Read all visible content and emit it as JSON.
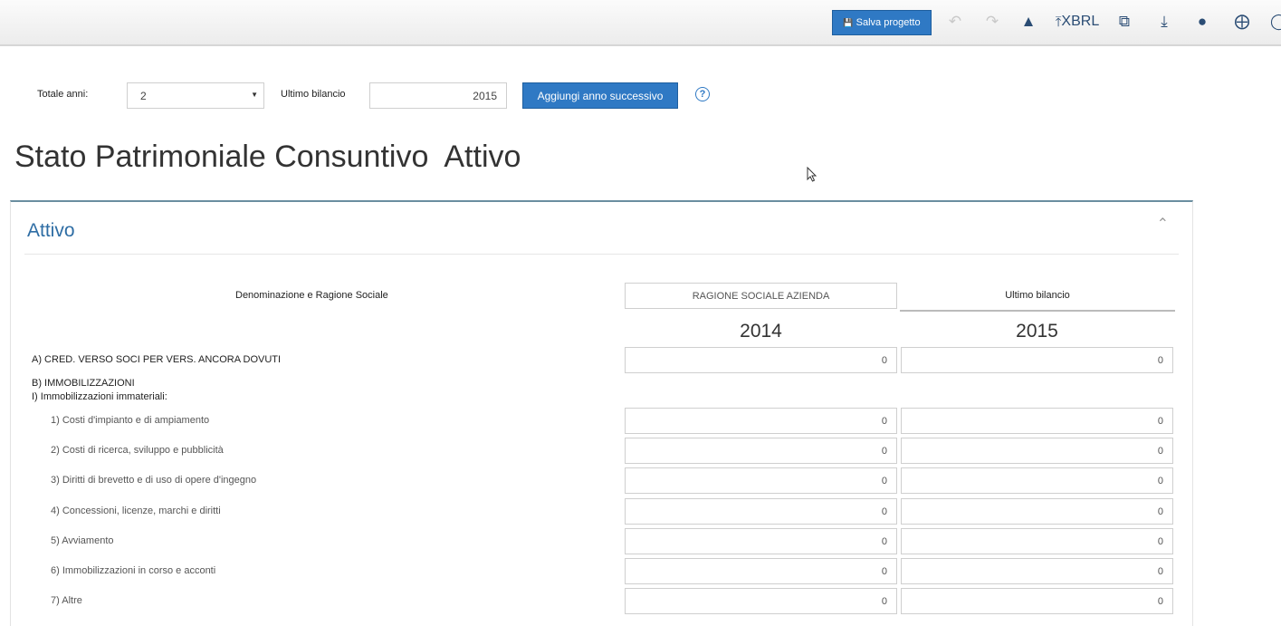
{
  "toolbar": {
    "save_label": "Salva progetto",
    "xbrl_label": "XBRL",
    "icons": [
      "undo-icon",
      "redo-icon",
      "warning-icon",
      "upload-icon",
      "copy-icon",
      "download-icon",
      "tag-icon",
      "lifebuoy-icon"
    ]
  },
  "controls": {
    "totale_anni_label": "Totale anni:",
    "totale_anni_value": "2",
    "ultimo_bilancio_label": "Ultimo bilancio",
    "ultimo_bilancio_value": "2015",
    "add_year_label": "Aggiungi anno successivo",
    "help_symbol": "?"
  },
  "page_title": "Stato Patrimoniale Consuntivo  Attivo",
  "panel": {
    "title": "Attivo",
    "denominazione_label": "Denominazione e Ragione Sociale",
    "denominazione_value": "RAGIONE SOCIALE AZIENDA",
    "ultimo_bilancio_col": "Ultimo bilancio",
    "years": [
      "2014",
      "2015"
    ]
  },
  "rows": {
    "r_a": {
      "label": "A) CRED. VERSO SOCI PER VERS. ANCORA DOVUTI",
      "v1": "0",
      "v2": "0"
    },
    "r_b_head": "B) IMMOBILIZZAZIONI",
    "r_b1_head": "I) Immobilizzazioni immateriali:",
    "r1": {
      "label": "1) Costi d'impianto e di ampiamento",
      "v1": "0",
      "v2": "0"
    },
    "r2": {
      "label": "2) Costi di ricerca, sviluppo e pubblicità",
      "v1": "0",
      "v2": "0"
    },
    "r3": {
      "label": "3) Diritti di brevetto e di uso di opere d'ingegno",
      "v1": "0",
      "v2": "0"
    },
    "r4": {
      "label": "4) Concessioni, licenze, marchi e diritti",
      "v1": "0",
      "v2": "0"
    },
    "r5": {
      "label": "5) Avviamento",
      "v1": "0",
      "v2": "0"
    },
    "r6": {
      "label": "6) Immobilizzazioni in corso e acconti",
      "v1": "0",
      "v2": "0"
    },
    "r7": {
      "label": "7) Altre",
      "v1": "0",
      "v2": "0"
    }
  }
}
